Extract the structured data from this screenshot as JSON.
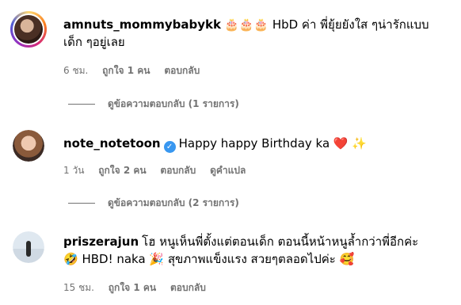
{
  "comments": [
    {
      "username": "amnuts_mommybabykk",
      "text": "🎂🎂🎂 HbD ค่า พี่ยุ้ยยังใส ๆน่ารักแบบ",
      "text2": "เด็ก ๆอยู่เลย",
      "time": "6 ชม.",
      "likes": "ถูกใจ 1 คน",
      "reply_label": "ตอบกลับ",
      "view_replies": "ดูข้อความตอบกลับ (1 รายการ)"
    },
    {
      "username": "note_notetoon",
      "verified_icon": "verified-badge-icon",
      "text": "Happy happy Birthday ka ❤️ ✨",
      "time": "1 วัน",
      "likes": "ถูกใจ 2 คน",
      "reply_label": "ตอบกลับ",
      "translate_label": "ดูคำแปล",
      "view_replies": "ดูข้อความตอบกลับ (2 รายการ)"
    },
    {
      "username": "priszerajun",
      "text": "โฮ หนูเห็นพี่ตั้งแต่ตอนเด็ก ตอนนี้หน้าหนูล้ำกว่าพี่อีกค่ะ",
      "text2": "🤣 HBD! naka 🎉 สุขภาพแข็งแรง สวยๆตลอดไปค่ะ 🥰",
      "time": "15 ชม.",
      "likes": "ถูกใจ 1 คน",
      "reply_label": "ตอบกลับ"
    }
  ]
}
